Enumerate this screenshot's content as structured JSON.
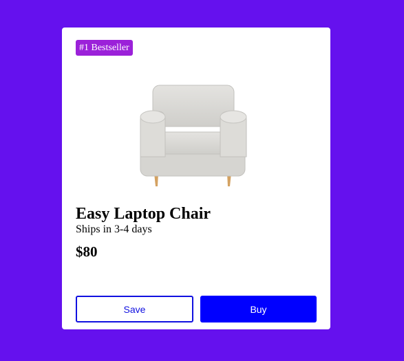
{
  "card": {
    "badge": "#1 Bestseller",
    "image_icon": "armchair-image",
    "title": "Easy Laptop Chair",
    "subtitle": "Ships in 3-4 days",
    "price": "$80",
    "save_label": "Save",
    "buy_label": "Buy"
  },
  "colors": {
    "background": "#6511ee",
    "badge": "#9b21d9",
    "primary": "#0000ff",
    "card": "#ffffff"
  }
}
